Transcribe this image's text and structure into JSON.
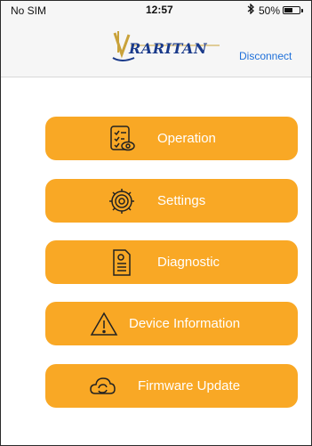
{
  "status_bar": {
    "carrier": "No SIM",
    "time": "12:57",
    "bluetooth_icon": "bluetooth-icon",
    "battery_percent": "50%",
    "battery_level": 0.5
  },
  "header": {
    "logo_text": "RARITAN",
    "disconnect_label": "Disconnect"
  },
  "menu": {
    "items": [
      {
        "label": "Operation",
        "icon": "checklist-eye-icon"
      },
      {
        "label": "Settings",
        "icon": "gear-icon"
      },
      {
        "label": "Diagnostic",
        "icon": "document-icon"
      },
      {
        "label": "Device Information",
        "icon": "warning-icon"
      },
      {
        "label": "Firmware Update",
        "icon": "cloud-sync-icon"
      }
    ]
  },
  "colors": {
    "button_bg": "#f9a825",
    "button_text": "#ffffff",
    "link": "#1e6fd9",
    "logo": "#1a3a8a"
  }
}
